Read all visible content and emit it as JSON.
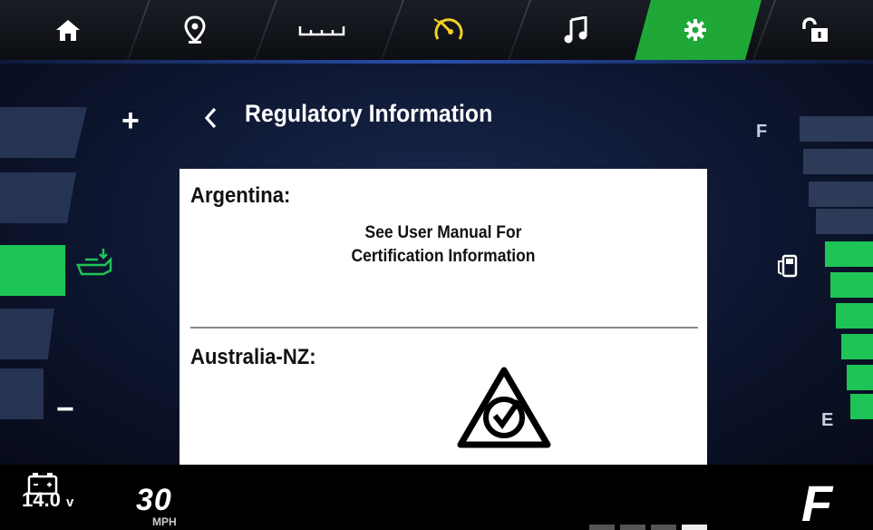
{
  "nav": {
    "tabs": [
      {
        "id": "home",
        "icon": "home-icon"
      },
      {
        "id": "location",
        "icon": "location-pin-icon"
      },
      {
        "id": "ruler",
        "icon": "ruler-icon"
      },
      {
        "id": "speedometer",
        "icon": "speedometer-icon",
        "color": "#f2d027"
      },
      {
        "id": "music",
        "icon": "music-note-icon"
      },
      {
        "id": "settings",
        "icon": "gear-icon",
        "active": true,
        "color": "#1fa838"
      },
      {
        "id": "lock",
        "icon": "unlock-icon"
      }
    ]
  },
  "screen": {
    "title": "Regulatory Information",
    "back_label": "<"
  },
  "left_gauge": {
    "plus": "+",
    "minus": "−",
    "icon": "boat-trim-icon",
    "level_segments_on": [
      3
    ]
  },
  "right_gauge": {
    "full_label": "F",
    "empty_label": "E",
    "icon": "fuel-pump-icon",
    "filled_segments": 6,
    "total_segments": 10
  },
  "regulatory": [
    {
      "country": "Argentina:",
      "message_line1": "See User Manual For",
      "message_line2": "Certification Information"
    },
    {
      "country": "Australia-NZ:",
      "mark": "rcm-compliance-mark-icon"
    }
  ],
  "status": {
    "voltage_value": "14.0",
    "voltage_unit": "v",
    "speed": "30",
    "speed_unit": "MPH",
    "gear": "F",
    "accent": "#1fc457"
  }
}
